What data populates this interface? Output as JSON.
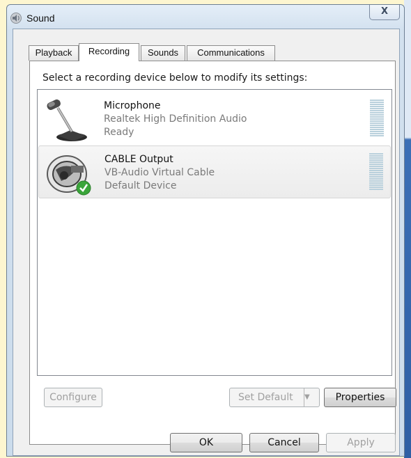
{
  "window": {
    "title": "Sound",
    "close_glyph": "X"
  },
  "tabs": [
    {
      "label": "Playback",
      "active": false
    },
    {
      "label": "Recording",
      "active": true
    },
    {
      "label": "Sounds",
      "active": false
    },
    {
      "label": "Communications",
      "active": false
    }
  ],
  "instruction": "Select a recording device below to modify its settings:",
  "devices": [
    {
      "name": "Microphone",
      "driver": "Realtek High Definition Audio",
      "status": "Ready",
      "icon": "microphone-icon",
      "selected": false
    },
    {
      "name": "CABLE Output",
      "driver": "VB-Audio Virtual Cable",
      "status": "Default Device",
      "icon": "cable-device-icon",
      "default_badge": "default-check-icon",
      "selected": true
    }
  ],
  "panel_buttons": {
    "configure": "Configure",
    "set_default": "Set Default",
    "properties": "Properties"
  },
  "dialog_buttons": {
    "ok": "OK",
    "cancel": "Cancel",
    "apply": "Apply"
  },
  "colors": {
    "title_bar": "#d3e1ef",
    "check_badge": "#3aa53a",
    "meter": "#b9d0dc",
    "page_background": "#fdf6d0"
  }
}
